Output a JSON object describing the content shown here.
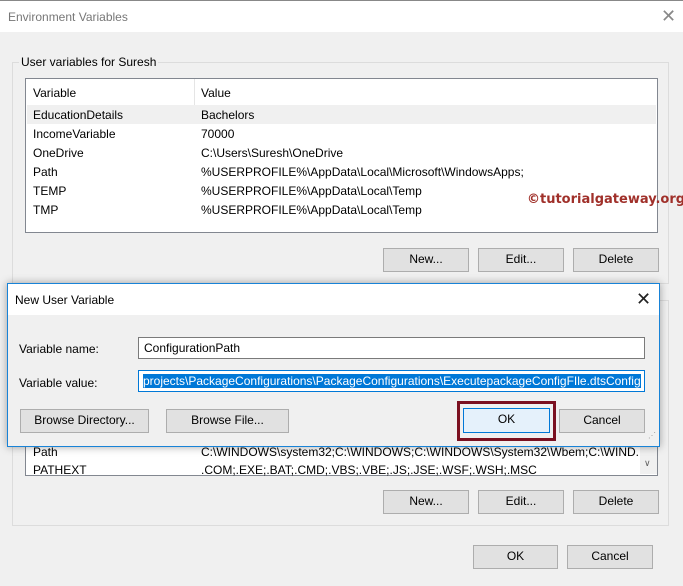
{
  "window": {
    "title": "Environment Variables",
    "close_icon": "close-icon"
  },
  "user_vars": {
    "group_label": "User variables for Suresh",
    "columns": [
      "Variable",
      "Value"
    ],
    "rows": [
      {
        "name": "EducationDetails",
        "value": "Bachelors"
      },
      {
        "name": "IncomeVariable",
        "value": "70000"
      },
      {
        "name": "OneDrive",
        "value": "C:\\Users\\Suresh\\OneDrive"
      },
      {
        "name": "Path",
        "value": "%USERPROFILE%\\AppData\\Local\\Microsoft\\WindowsApps;"
      },
      {
        "name": "TEMP",
        "value": "%USERPROFILE%\\AppData\\Local\\Temp"
      },
      {
        "name": "TMP",
        "value": "%USERPROFILE%\\AppData\\Local\\Temp"
      }
    ],
    "new_label": "New...",
    "edit_label": "Edit...",
    "delete_label": "Delete"
  },
  "watermark": "©tutorialgateway.org",
  "system_vars": {
    "rows": [
      {
        "name": "Path",
        "value": "C:\\WINDOWS\\system32;C:\\WINDOWS;C:\\WINDOWS\\System32\\Wbem;C:\\WIND..."
      },
      {
        "name": "PATHEXT",
        "value": ".COM;.EXE;.BAT;.CMD;.VBS;.VBE;.JS;.JSE;.WSF;.WSH;.MSC"
      }
    ],
    "new_label": "New...",
    "edit_label": "Edit...",
    "delete_label": "Delete"
  },
  "footer": {
    "ok_label": "OK",
    "cancel_label": "Cancel"
  },
  "dialog": {
    "title": "New User Variable",
    "name_label": "Variable name:",
    "name_value": "ConfigurationPath",
    "value_label": "Variable value:",
    "value_value": "projects\\PackageConfigurations\\PackageConfigurations\\ExecutepackageConfigFIle.dtsConfig",
    "browse_dir_label": "Browse Directory...",
    "browse_file_label": "Browse File...",
    "ok_label": "OK",
    "cancel_label": "Cancel",
    "highlight_color": "#7b1020"
  }
}
